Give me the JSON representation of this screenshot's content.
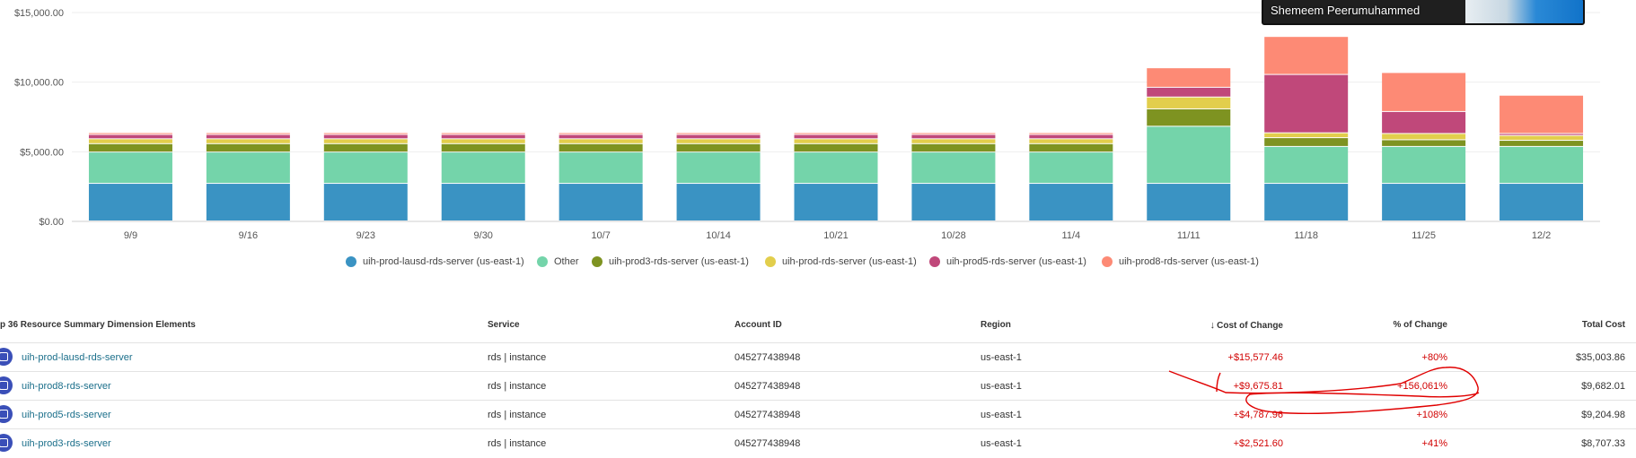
{
  "chart_data": {
    "type": "bar",
    "stacked": true,
    "categories": [
      "9/9",
      "9/16",
      "9/23",
      "9/30",
      "10/7",
      "10/14",
      "10/21",
      "10/28",
      "11/4",
      "11/11",
      "11/18",
      "11/25",
      "12/2"
    ],
    "yticks": [
      "$0.00",
      "$5,000.00",
      "$10,000.00",
      "$15,000.00"
    ],
    "ylim": [
      0,
      15000
    ],
    "series": [
      {
        "name": "uih-prod-lausd-rds-server (us-east-1)",
        "color": "#3a93c3",
        "values": [
          2700,
          2700,
          2700,
          2700,
          2700,
          2700,
          2700,
          2700,
          2700,
          2700,
          2700,
          2700,
          2700
        ]
      },
      {
        "name": "Other",
        "color": "#74d4aa",
        "values": [
          2250,
          2250,
          2250,
          2250,
          2250,
          2250,
          2250,
          2250,
          2250,
          4100,
          2650,
          2650,
          2650
        ]
      },
      {
        "name": "uih-prod3-rds-server (us-east-1)",
        "color": "#7e9321",
        "values": [
          600,
          600,
          600,
          600,
          600,
          600,
          600,
          600,
          600,
          1250,
          630,
          480,
          440
        ]
      },
      {
        "name": "uih-prod-rds-server (us-east-1)",
        "color": "#e2ce4c",
        "values": [
          350,
          350,
          350,
          350,
          350,
          350,
          350,
          350,
          350,
          850,
          350,
          450,
          350
        ]
      },
      {
        "name": "uih-prod5-rds-server (us-east-1)",
        "color": "#c0487a",
        "values": [
          310,
          310,
          310,
          310,
          310,
          310,
          310,
          310,
          310,
          700,
          4190,
          1580,
          140
        ]
      },
      {
        "name": "uih-prod8-rds-server (us-east-1)",
        "color": "#fd8a75",
        "values": [
          130,
          130,
          130,
          130,
          130,
          130,
          130,
          130,
          130,
          1400,
          2730,
          2800,
          2750
        ]
      }
    ],
    "legend_position": "bottom",
    "grid": true
  },
  "overlay": {
    "participant_name": "Shemeem Peerumuhammed"
  },
  "table": {
    "headers": {
      "name": "p 36 Resource Summary Dimension Elements",
      "service": "Service",
      "account": "Account ID",
      "region": "Region",
      "cost_change": "Cost of Change",
      "pct_change": "% of Change",
      "total": "Total Cost"
    },
    "sort_indicator": "↓",
    "rows": [
      {
        "name": "uih-prod-lausd-rds-server",
        "service": "rds | instance",
        "account": "045277438948",
        "region": "us-east-1",
        "cost_change": "+$15,577.46",
        "pct_change": "+80%",
        "total": "$35,003.86"
      },
      {
        "name": "uih-prod8-rds-server",
        "service": "rds | instance",
        "account": "045277438948",
        "region": "us-east-1",
        "cost_change": "+$9,675.81",
        "pct_change": "+156,061%",
        "total": "$9,682.01"
      },
      {
        "name": "uih-prod5-rds-server",
        "service": "rds | instance",
        "account": "045277438948",
        "region": "us-east-1",
        "cost_change": "+$4,787.96",
        "pct_change": "+108%",
        "total": "$9,204.98"
      },
      {
        "name": "uih-prod3-rds-server",
        "service": "rds | instance",
        "account": "045277438948",
        "region": "us-east-1",
        "cost_change": "+$2,521.60",
        "pct_change": "+41%",
        "total": "$8,707.33"
      }
    ]
  },
  "colors": {
    "link": "#1a6e8a",
    "negative_highlight": "#d10000",
    "annotation": "#e00000"
  }
}
